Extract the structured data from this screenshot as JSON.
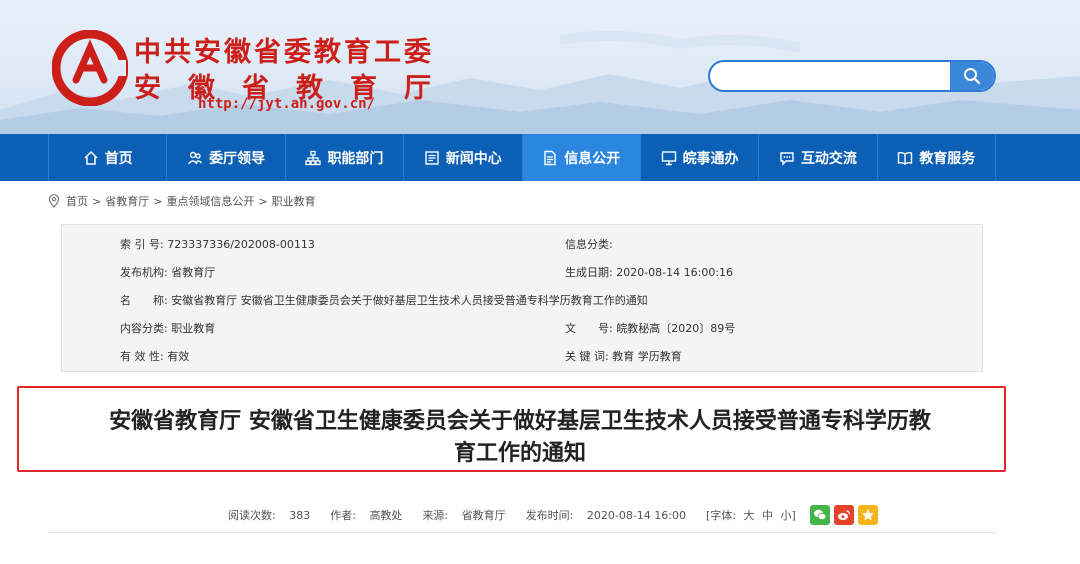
{
  "header": {
    "site_title_line1": "中共安徽省委教育工委",
    "site_title_line2": "安徽省教育厅",
    "site_url": "http://jyt.ah.gov.cn/",
    "search": {
      "placeholder": "",
      "value": ""
    }
  },
  "nav": {
    "items": [
      {
        "label": "首页",
        "icon": "home-icon"
      },
      {
        "label": "委厅领导",
        "icon": "leaders-icon"
      },
      {
        "label": "职能部门",
        "icon": "org-chart-icon"
      },
      {
        "label": "新闻中心",
        "icon": "news-icon"
      },
      {
        "label": "信息公开",
        "icon": "document-icon",
        "active": true
      },
      {
        "label": "皖事通办",
        "icon": "monitor-icon"
      },
      {
        "label": "互动交流",
        "icon": "chat-icon"
      },
      {
        "label": "教育服务",
        "icon": "book-icon"
      }
    ]
  },
  "breadcrumb": {
    "items": [
      "首页",
      "省教育厅",
      "重点领域信息公开",
      "职业教育"
    ],
    "separator": ">"
  },
  "meta": {
    "index_no": {
      "label": "索 引 号:",
      "value": "723337336/202008-00113"
    },
    "info_category": {
      "label": "信息分类:",
      "value": ""
    },
    "publisher": {
      "label": "发布机构:",
      "value": "省教育厅"
    },
    "created_date": {
      "label": "生成日期:",
      "value": "2020-08-14 16:00:16"
    },
    "name": {
      "label": "名　　称:",
      "value": "安徽省教育厅 安徽省卫生健康委员会关于做好基层卫生技术人员接受普通专科学历教育工作的通知"
    },
    "content_category": {
      "label": "内容分类:",
      "value": "职业教育"
    },
    "doc_no": {
      "label": "文　　号:",
      "value": "皖教秘高〔2020〕89号"
    },
    "validity": {
      "label": "有 效 性:",
      "value": "有效"
    },
    "keywords": {
      "label": "关 键 词:",
      "value": "教育 学历教育"
    }
  },
  "article": {
    "title_line1": "安徽省教育厅 安徽省卫生健康委员会关于做好基层卫生技术人员接受普通专科学历教",
    "title_line2": "育工作的通知",
    "views_label": "阅读次数:",
    "views": "383",
    "author_label": "作者:",
    "author": "高教处",
    "source_label": "来源:",
    "source": "省教育厅",
    "time_label": "发布时间:",
    "time": "2020-08-14 16:00",
    "font_label": "[字体:",
    "font_large": "大",
    "font_medium": "中",
    "font_small": "小]"
  },
  "colors": {
    "brand_red": "#cc1f1a",
    "nav_blue": "#0b5fb5",
    "nav_active": "#2a86de",
    "highlight_border": "#e0282a"
  }
}
